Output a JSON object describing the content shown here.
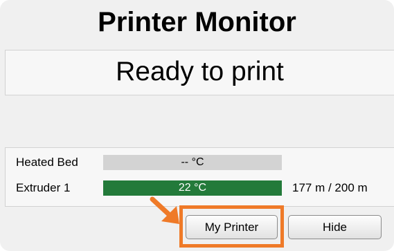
{
  "window": {
    "title": "Printer Monitor"
  },
  "status": {
    "text": "Ready to print"
  },
  "temperatures": [
    {
      "label": "Heated Bed",
      "value": "-- °C",
      "fill_fraction": 0,
      "fill_color": "#d3d3d3",
      "filament": ""
    },
    {
      "label": "Extruder 1",
      "value": "22 °C",
      "fill_fraction": 1,
      "fill_color": "#237a3a",
      "filament": "177 m / 200 m"
    }
  ],
  "buttons": {
    "my_printer": "My Printer",
    "hide": "Hide"
  },
  "colors": {
    "window_bg": "#f0f0f0",
    "highlight": "#ef7a28",
    "extruder_bar": "#237a3a",
    "bed_bar": "#d3d3d3"
  },
  "annotation": {
    "highlight_target": "my-printer-button",
    "icon": "arrow-pointer-icon"
  }
}
